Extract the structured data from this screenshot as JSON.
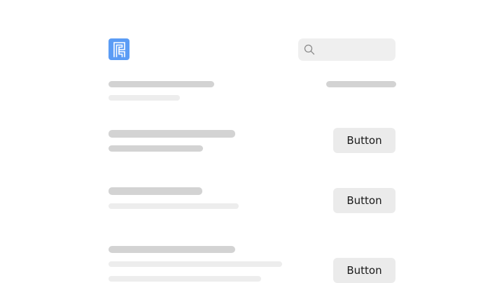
{
  "header": {
    "logo_icon": "app-logo-icon",
    "logo_color": "#5b9cf5",
    "search_icon": "search-icon",
    "search_placeholder": ""
  },
  "rows": [
    {
      "button_label": "Button"
    },
    {
      "button_label": "Button"
    },
    {
      "button_label": "Button"
    }
  ]
}
